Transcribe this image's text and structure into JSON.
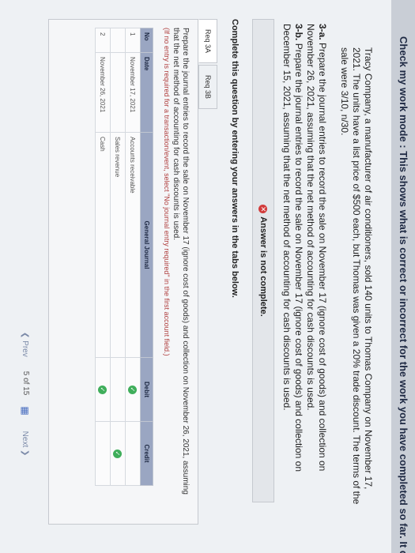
{
  "banner": "Check my work mode : This shows what is correct or incorrect for the work you have completed so far. It does not ind",
  "intro": "Tracy Company, a manufacturer of air conditioners, sold 140 units to Thomas Company on November 17, 2021. The units have a list price of $500 each, but Thomas was given a 20% trade discount. The terms of the sale were 3/10, n/30.",
  "part_a": {
    "label": "3-a.",
    "text": "Prepare the journal entries to record the sale on November 17 (ignore cost of goods) and collection on November 26, 2021, assuming that the net method of accounting for cash discounts is used."
  },
  "part_b": {
    "label": "3-b.",
    "text": "Prepare the journal entries to record the sale on November 17 (ignore cost of goods) and collection on December 15, 2021, assuming that the net method of accounting for cash discounts is used."
  },
  "status": "Answer is not complete.",
  "instructions": "Complete this question by entering your answers in the tabs below.",
  "tabs": [
    "Req 3A",
    "Req 3B"
  ],
  "prepare_text": "Prepare the journal entries to record the sale on November 17 (ignore cost of goods) and collection on November 26, 2021, assuming that the net method of accounting for cash discounts is used.",
  "note": "(If no entry is required for a transaction/event, select \"No journal entry required\" in the first account field.)",
  "table": {
    "headers": {
      "no": "No",
      "date": "Date",
      "account": "General Journal",
      "debit": "Debit",
      "credit": "Credit"
    },
    "rows": [
      {
        "no": "1",
        "date": "November 17, 2021",
        "account": "Accounts receivable",
        "indent": false,
        "debit_check": true,
        "credit_check": false
      },
      {
        "no": "",
        "date": "",
        "account": "Sales revenue",
        "indent": true,
        "debit_check": false,
        "credit_check": true
      },
      {
        "no": "2",
        "date": "November 26, 2021",
        "account": "Cash",
        "indent": false,
        "debit_check": true,
        "credit_check": false
      }
    ]
  },
  "nav": {
    "prev": "Prev",
    "page": "5",
    "of": "of 15",
    "next": "Next"
  }
}
